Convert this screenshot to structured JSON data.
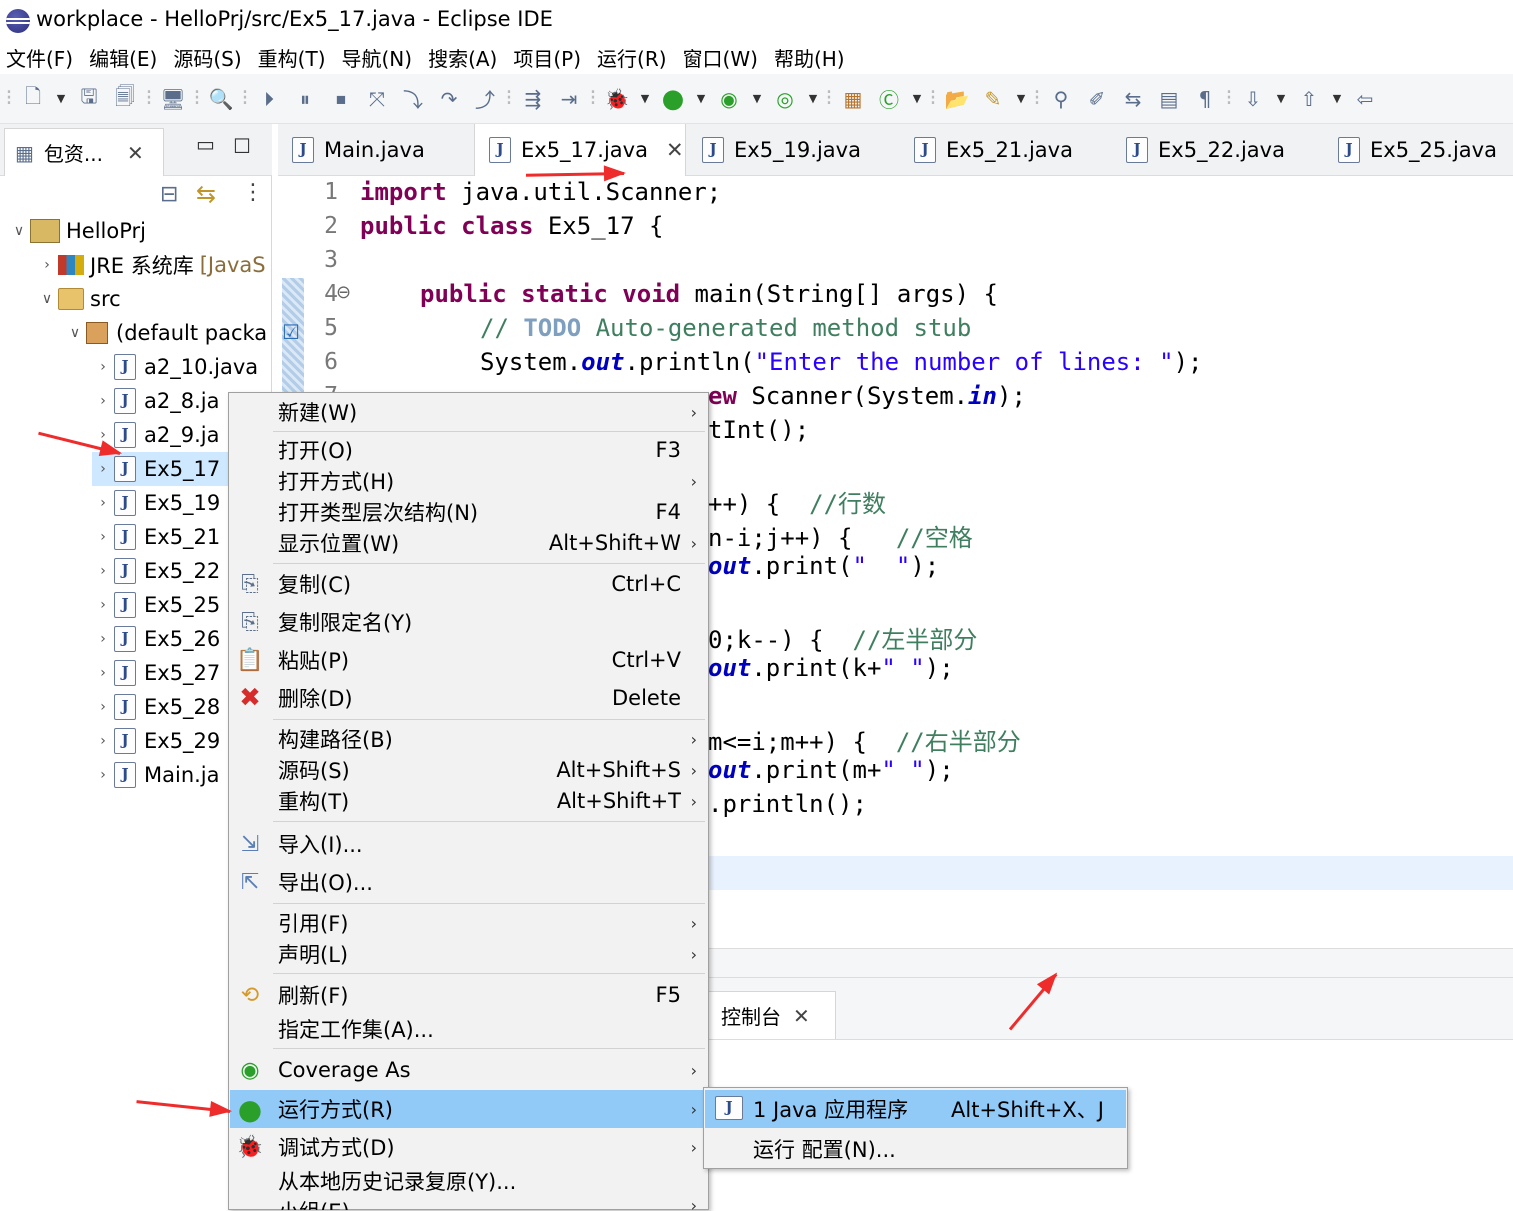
{
  "window": {
    "title": "workplace - HelloPrj/src/Ex5_17.java - Eclipse IDE"
  },
  "menubar": [
    "文件(F)",
    "编辑(E)",
    "源码(S)",
    "重构(T)",
    "导航(N)",
    "搜索(A)",
    "项目(P)",
    "运行(R)",
    "窗口(W)",
    "帮助(H)"
  ],
  "explorer": {
    "tab_label": "包资...",
    "project": "HelloPrj",
    "jre_label": "JRE 系统库",
    "jre_suffix": "[JavaS",
    "src": "src",
    "package": "(default packa",
    "files": [
      "a2_10.java",
      "a2_8.ja",
      "a2_9.ja",
      "Ex5_17",
      "Ex5_19",
      "Ex5_21",
      "Ex5_22",
      "Ex5_25",
      "Ex5_26",
      "Ex5_27",
      "Ex5_28",
      "Ex5_29",
      "Main.ja"
    ]
  },
  "editor": {
    "tabs": [
      "Main.java",
      "Ex5_17.java",
      "Ex5_19.java",
      "Ex5_21.java",
      "Ex5_22.java",
      "Ex5_25.java"
    ],
    "active_tab": "Ex5_17.java",
    "line_numbers": [
      "1",
      "2",
      "3",
      "4",
      "5",
      "6",
      "7"
    ],
    "code": {
      "l1_kw": "import",
      "l1_rest": " java.util.Scanner;",
      "l2_kw1": "public",
      "l2_kw2": "class",
      "l2_rest": " Ex5_17 {",
      "l4_kw": "public static void",
      "l4_rest": " main(String[] args) {",
      "l5_cmt1": "// ",
      "l5_todo": "TODO",
      "l5_cmt2": " Auto-generated method stub",
      "l6_a": "System.",
      "l6_fld": "out",
      "l6_b": ".println(",
      "l6_str": "\"Enter the number of lines: \"",
      "l6_c": ");",
      "l7_kw": "ew",
      "l7_a": " Scanner(System.",
      "l7_fld": "in",
      "l7_b": ");",
      "l8": "tInt();",
      "l10_a": "++) {  ",
      "l10_cmt": "//行数",
      "l11_a": "n-i;j++) {   ",
      "l11_cmt": "//空格",
      "l12_fld": "out",
      "l12_a": ".print(",
      "l12_str": "\"  \"",
      "l12_b": ");",
      "l14_a": "0;k--) {  ",
      "l14_cmt": "//左半部分",
      "l15_fld": "out",
      "l15_a": ".print(k+",
      "l15_str": "\" \"",
      "l15_b": ");",
      "l17_a": "m<=i;m++) {  ",
      "l17_cmt": "//右半部分",
      "l18_fld": "out",
      "l18_a": ".print(m+",
      "l18_str": "\" \"",
      "l18_b": ");",
      "l19": ".println();"
    }
  },
  "console": {
    "tab_label": "控制台"
  },
  "context_menu": {
    "items": [
      {
        "label": "新建(W)",
        "key": "",
        "sub": true
      },
      {
        "label": "打开(O)",
        "key": "F3",
        "sub": false
      },
      {
        "label": "打开方式(H)",
        "key": "",
        "sub": true
      },
      {
        "label": "打开类型层次结构(N)",
        "key": "F4",
        "sub": false
      },
      {
        "label": "显示位置(W)",
        "key": "Alt+Shift+W",
        "sub": true
      },
      {
        "label": "复制(C)",
        "key": "Ctrl+C",
        "sub": false
      },
      {
        "label": "复制限定名(Y)",
        "key": "",
        "sub": false
      },
      {
        "label": "粘贴(P)",
        "key": "Ctrl+V",
        "sub": false
      },
      {
        "label": "删除(D)",
        "key": "Delete",
        "sub": false
      },
      {
        "label": "构建路径(B)",
        "key": "",
        "sub": true
      },
      {
        "label": "源码(S)",
        "key": "Alt+Shift+S",
        "sub": true
      },
      {
        "label": "重构(T)",
        "key": "Alt+Shift+T",
        "sub": true
      },
      {
        "label": "导入(I)...",
        "key": "",
        "sub": false
      },
      {
        "label": "导出(O)...",
        "key": "",
        "sub": false
      },
      {
        "label": "引用(F)",
        "key": "",
        "sub": true
      },
      {
        "label": "声明(L)",
        "key": "",
        "sub": true
      },
      {
        "label": "刷新(F)",
        "key": "F5",
        "sub": false
      },
      {
        "label": "指定工作集(A)...",
        "key": "",
        "sub": false
      },
      {
        "label": "Coverage As",
        "key": "",
        "sub": true
      },
      {
        "label": "运行方式(R)",
        "key": "",
        "sub": true
      },
      {
        "label": "调试方式(D)",
        "key": "",
        "sub": true
      },
      {
        "label": "从本地历史记录复原(Y)...",
        "key": "",
        "sub": false
      },
      {
        "label": "小组(E)",
        "key": "",
        "sub": true
      }
    ],
    "highlighted": "运行方式(R)"
  },
  "submenu": {
    "items": [
      {
        "label": "1 Java 应用程序",
        "key": "Alt+Shift+X、J"
      },
      {
        "label": "运行 配置(N)...",
        "key": ""
      }
    ]
  },
  "colors": {
    "menu_highlight": "#91c9f7",
    "annotation_arrow": "#ee2c2c",
    "keyword": "#7f0055",
    "string": "#2a00ff",
    "comment": "#3f7f5f"
  }
}
